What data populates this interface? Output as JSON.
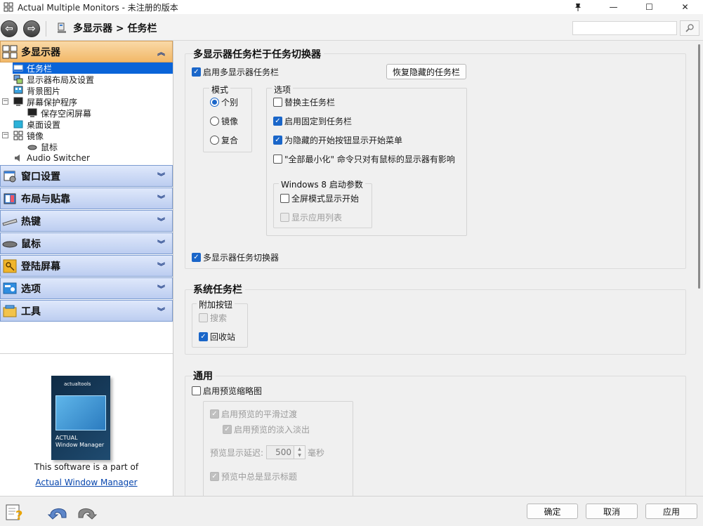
{
  "window": {
    "title": "Actual Multiple Monitors - 未注册的版本",
    "controls": {
      "pin": "pin-icon",
      "minimize": "—",
      "maximize": "☐",
      "close": "✕"
    }
  },
  "toolbar": {
    "breadcrumb": "多显示器 > 任务栏",
    "search_value": "",
    "search_placeholder": ""
  },
  "sidebar": {
    "active_category": "多显示器",
    "tree": [
      {
        "label": "任务栏",
        "selected": true
      },
      {
        "label": "显示器布局及设置"
      },
      {
        "label": "背景图片"
      },
      {
        "label": "屏幕保护程序",
        "expander": "⊟"
      },
      {
        "label": "保存空闲屏幕"
      },
      {
        "label": "桌面设置"
      },
      {
        "label": "镜像",
        "expander": "⊟"
      },
      {
        "label": "鼠标"
      },
      {
        "label": "Audio Switcher"
      }
    ],
    "categories": [
      {
        "label": "窗口设置"
      },
      {
        "label": "布局与贴靠"
      },
      {
        "label": "热键"
      },
      {
        "label": "鼠标"
      },
      {
        "label": "登陆屏幕"
      },
      {
        "label": "选项"
      },
      {
        "label": "工具"
      }
    ],
    "promo": {
      "box_title_line1": "ACTUAL",
      "box_title_line2": "Window Manager",
      "box_logo": "actualtools",
      "text": "This software is a part of",
      "link": "Actual Window Manager"
    }
  },
  "main": {
    "section1": {
      "title": "多显示器任务栏于任务切换器",
      "enable_taskbar": {
        "label": "启用多显示器任务栏",
        "checked": true
      },
      "restore_button": "恢复隐藏的任务栏",
      "mode_group": {
        "label": "模式",
        "options": [
          {
            "label": "个别",
            "selected": true
          },
          {
            "label": "镜像",
            "selected": false
          },
          {
            "label": "复合",
            "selected": false
          }
        ]
      },
      "options_group": {
        "label": "选项",
        "items": [
          {
            "label": "替换主任务栏",
            "checked": false
          },
          {
            "label": "启用固定到任务栏",
            "checked": true
          },
          {
            "label": "为隐藏的开始按钮显示开始菜单",
            "checked": true
          },
          {
            "label": "\"全部最小化\" 命令只对有鼠标的显示器有影响",
            "checked": false
          }
        ],
        "win8_group": {
          "label": "Windows 8 启动参数",
          "items": [
            {
              "label": "全屏模式显示开始",
              "checked": false,
              "disabled": false
            },
            {
              "label": "显示应用列表",
              "checked": false,
              "disabled": true
            }
          ]
        }
      },
      "task_switcher": {
        "label": "多显示器任务切换器",
        "checked": true
      }
    },
    "section2": {
      "title": "系统任务栏",
      "group_label": "附加按钮",
      "items": [
        {
          "label": "搜索",
          "checked": false,
          "disabled": true
        },
        {
          "label": "回收站",
          "checked": true,
          "disabled": false
        }
      ]
    },
    "section3": {
      "title": "通用",
      "enable_preview": {
        "label": "启用预览缩略图",
        "checked": false
      },
      "smooth": {
        "label": "启用预览的平滑过渡",
        "checked": true
      },
      "fade": {
        "label": "启用预览的淡入淡出",
        "checked": true
      },
      "delay_label": "预览显示延迟:",
      "delay_value": "500",
      "delay_unit": "毫秒",
      "always_title": {
        "label": "预览中总是显示标题",
        "checked": true
      }
    }
  },
  "footer": {
    "ok": "确定",
    "cancel": "取消",
    "apply": "应用"
  }
}
